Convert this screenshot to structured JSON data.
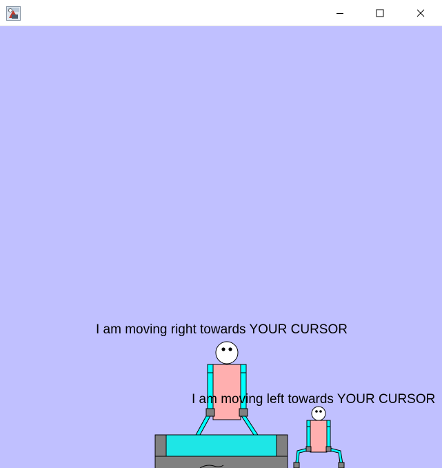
{
  "window": {
    "title": "",
    "icon": "java-app-icon",
    "controls": {
      "minimize_icon": "minimize-icon",
      "maximize_icon": "maximize-icon",
      "close_icon": "close-icon"
    }
  },
  "scene": {
    "background_color": "#c0c0ff",
    "characters": [
      {
        "speech": "I am moving right towards YOUR CURSOR",
        "body_color": "#ffafaf",
        "limb_color": "#00ffff",
        "joint_color": "#808080"
      },
      {
        "speech": "I am moving left towards YOUR CURSOR",
        "body_color": "#ffafaf",
        "limb_color": "#00ffff",
        "joint_color": "#808080"
      }
    ],
    "platform": {
      "top_color": "#1ee6e6",
      "frame_color": "#808080"
    }
  }
}
